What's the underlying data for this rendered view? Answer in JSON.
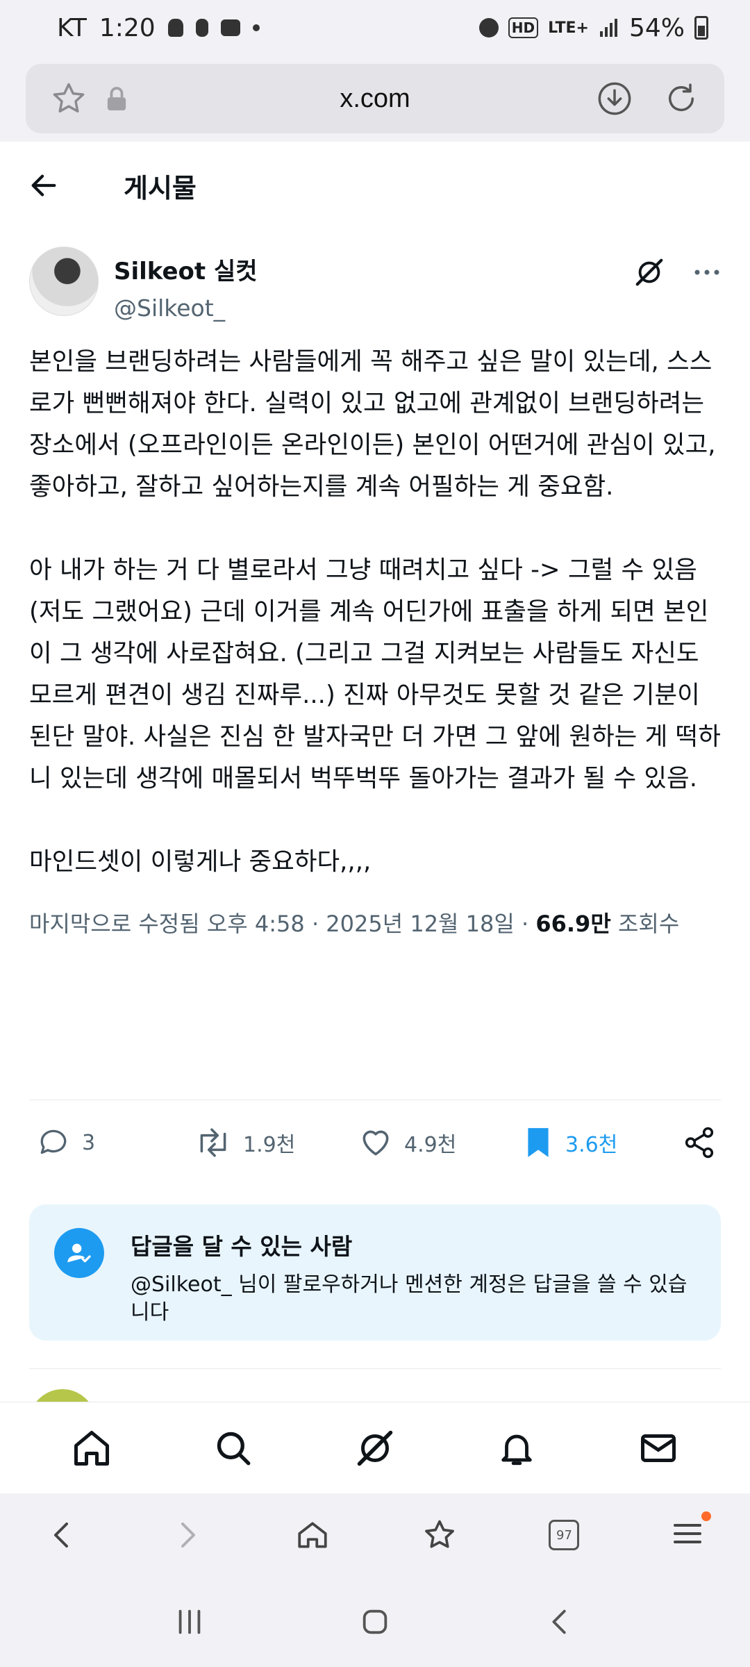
{
  "status_bar": {
    "carrier": "KT",
    "time": "1:20",
    "hd": "HD",
    "network": "LTE+",
    "battery": "54%"
  },
  "browser": {
    "url": "x.com"
  },
  "header": {
    "title": "게시물"
  },
  "post": {
    "author_name": "Silkeot 실컷",
    "author_handle": "@Silkeot_",
    "text": "본인을 브랜딩하려는 사람들에게 꼭 해주고 싶은 말이 있는데, 스스로가 뻔뻔해져야 한다. 실력이 있고 없고에 관계없이 브랜딩하려는 장소에서 (오프라인이든 온라인이든) 본인이 어떤거에 관심이 있고, 좋아하고, 잘하고 싶어하는지를 계속 어필하는 게 중요함.\n\n아 내가 하는 거 다 별로라서 그냥 때려치고 싶다 -> 그럴 수 있음 (저도 그랬어요) 근데 이거를 계속 어딘가에 표출을 하게 되면 본인이 그 생각에 사로잡혀요. (그리고 그걸 지켜보는 사람들도 자신도 모르게 편견이 생김 진짜루...) 진짜 아무것도 못할 것 같은 기분이 된단 말야. 사실은 진심 한 발자국만 더 가면 그 앞에 원하는 게 떡하니 있는데 생각에 매몰되서 벅뚜벅뚜 돌아가는 결과가 될 수 있음.\n\n마인드셋이 이렇게나 중요하다,,,,",
    "meta_prefix": "마지막으로 수정됨 오후 4:58 · 2025년 12월 18일 · ",
    "views_count": "66.9만",
    "views_label": " 조회수"
  },
  "actions": {
    "replies": "3",
    "reposts": "1.9천",
    "likes": "4.9천",
    "bookmarks": "3.6천"
  },
  "reply_settings": {
    "title": "답글을 달 수 있는 사람",
    "description": "@Silkeot_ 님이 팔로우하거나 멘션한 계정은 답글을 쓸 수 있습니다"
  },
  "browser_toolbar": {
    "tab_count": "97"
  },
  "colors": {
    "accent": "#1d9bf0",
    "secondary_text": "#536471",
    "reply_card_bg": "#e8f5fd"
  }
}
